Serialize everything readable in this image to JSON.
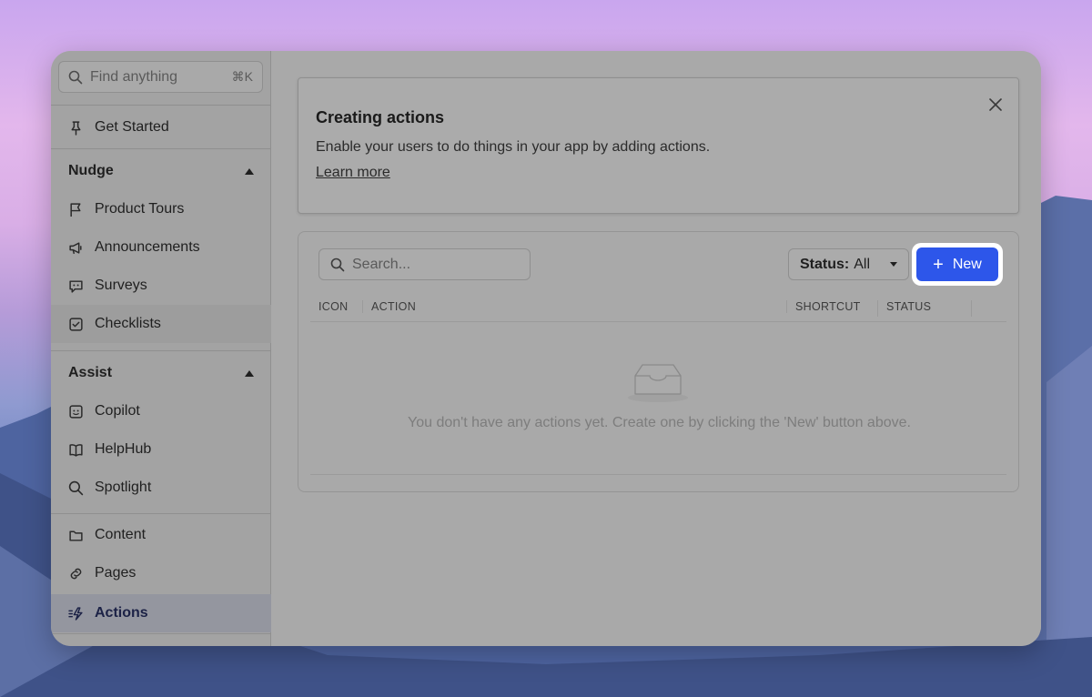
{
  "sidebar": {
    "search": {
      "placeholder": "Find anything",
      "shortcut": "⌘K"
    },
    "get_started": "Get Started",
    "sections": [
      {
        "title": "Nudge",
        "items": [
          "Product Tours",
          "Announcements",
          "Surveys",
          "Checklists"
        ]
      },
      {
        "title": "Assist",
        "items": [
          "Copilot",
          "HelpHub",
          "Spotlight"
        ]
      }
    ],
    "bottom_items": [
      "Content",
      "Pages",
      "Actions"
    ]
  },
  "banner": {
    "title": "Creating actions",
    "description": "Enable your users to do things in your app by adding actions.",
    "link": "Learn more"
  },
  "panel": {
    "search_placeholder": "Search...",
    "status_label": "Status:",
    "status_value": "All",
    "new_button": "New",
    "columns": [
      "ICON",
      "ACTION",
      "SHORTCUT",
      "STATUS"
    ],
    "empty_message": "You don't have any actions yet. Create one by clicking the 'New' button above."
  },
  "colors": {
    "accent": "#2d56ea",
    "overlay": "#a9a9a9"
  }
}
